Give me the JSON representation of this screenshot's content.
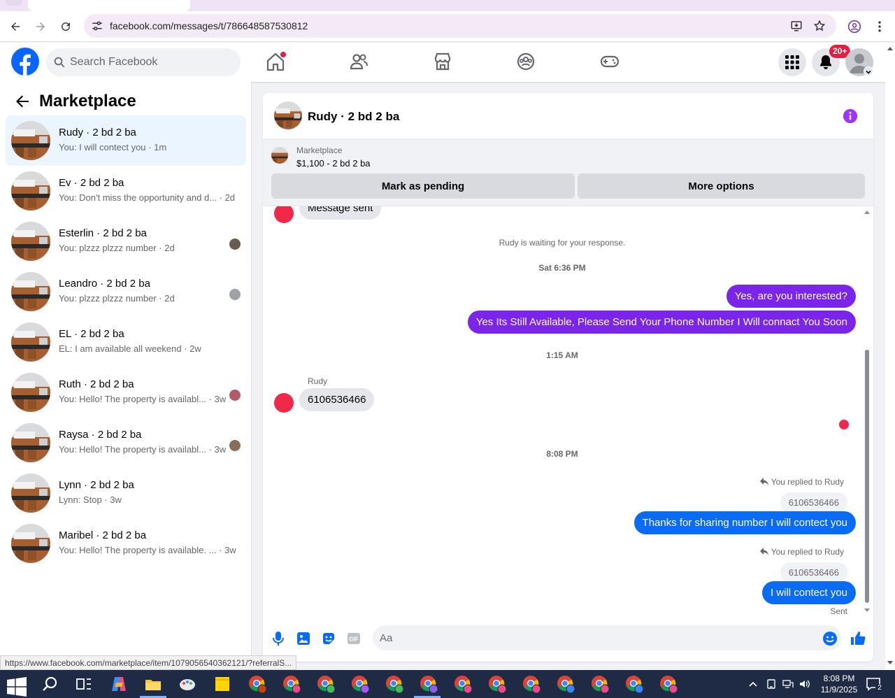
{
  "browser": {
    "url": "facebook.com/messages/t/786648587530812",
    "status_url": "https://www.facebook.com/marketplace/item/1079056540362121/?referralS..."
  },
  "header": {
    "search_placeholder": "Search Facebook",
    "notification_badge": "20+",
    "colors": {
      "brand": "#0866ff",
      "alert": "#e41e3f"
    },
    "icons": [
      "home-icon",
      "friends-icon",
      "marketplace-icon",
      "groups-icon",
      "gaming-icon",
      "menu-grid-icon",
      "bell-icon",
      "profile-icon"
    ]
  },
  "sidebar": {
    "title": "Marketplace",
    "conversations": [
      {
        "name": "Rudy · 2 bd 2 ba",
        "preview": "You: I will contect you · 1m",
        "active": true
      },
      {
        "name": "Ev · 2 bd 2 ba",
        "preview": "You: Don't miss the opportunity and d... · 2d"
      },
      {
        "name": "Esterlin · 2 bd 2 ba",
        "preview": "You: plzzz plzzz number · 2d"
      },
      {
        "name": "Leandro · 2 bd 2 ba",
        "preview": "You: plzzz plzzz number · 2d"
      },
      {
        "name": "EL · 2 bd 2 ba",
        "preview": "EL: I am available all weekend · 2w"
      },
      {
        "name": "Ruth · 2 bd 2 ba",
        "preview": "You: Hello! The property is availabl... · 3w"
      },
      {
        "name": "Raysa · 2 bd 2 ba",
        "preview": "You: Hello! The property is availabl... · 3w"
      },
      {
        "name": "Lynn · 2 bd 2 ba",
        "preview": "Lynn: Stop · 3w"
      },
      {
        "name": "Maribel · 2 bd 2 ba",
        "preview": "You: Hello! The property is available. ... · 3w"
      }
    ]
  },
  "chat": {
    "title": "Rudy · 2 bd 2 ba",
    "listing": {
      "label": "Marketplace",
      "price": "$1,100 - 2 bd 2 ba"
    },
    "buttons": {
      "pending": "Mark as pending",
      "more": "More options"
    },
    "messages": {
      "partial_top": "Message sent",
      "waiting": "Rudy is waiting for your response.",
      "ts1": "Sat 6:36 PM",
      "out1": "Yes, are you interested?",
      "out2": "Yes Its Still Available, Please Send Your Phone Number I Will connact You Soon",
      "ts2": "1:15 AM",
      "sender": "Rudy",
      "in1": "6106536466",
      "ts3": "8:08 PM",
      "reply_label_1": "You replied to Rudy",
      "quote_1": "6106536466",
      "out3": "Thanks for sharing number I will contect you",
      "reply_label_2": "You replied to Rudy",
      "quote_2": "6106536466",
      "out4": "I will contect you",
      "status": "Sent"
    },
    "composer_placeholder": "Aa",
    "colors": {
      "outgoing_purple": "#7b25ea",
      "outgoing_blue": "#0a6cf4",
      "info": "#a033ff"
    }
  },
  "taskbar": {
    "time": "8:08 PM",
    "date": "11/9/2025",
    "notification_count": "2"
  }
}
